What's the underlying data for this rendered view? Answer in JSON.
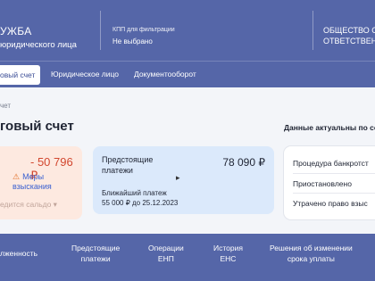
{
  "header": {
    "brand_title": "УЖБА",
    "brand_subtitle": "юридического лица",
    "kpp_label": "КПП для фильтрации",
    "kpp_value": "Не выбрано",
    "org_line1": "ОБЩЕСТВО С",
    "org_line2": "ОТВЕТСТВЕНН"
  },
  "tabs": [
    {
      "label": "овый счет"
    },
    {
      "label": "Юридическое лицо"
    },
    {
      "label": "Документооборот"
    }
  ],
  "main": {
    "breadcrumb": "чет",
    "title": "говый счет",
    "actual_note": "Данные актуальны по со"
  },
  "debt_card": {
    "amount": "- 50 796 ₽",
    "action": "Меры взыскания",
    "note": "едится сальдо ▾"
  },
  "upcoming_card": {
    "title_line1": "Предстоящие",
    "title_line2": "платежи",
    "amount": "78 090 ₽",
    "next_label": "Ближайший платеж",
    "next_value": "55 000 ₽ до 25.12.2023"
  },
  "status_card": {
    "items": [
      "Процедура банкротст",
      "Приостановлено",
      "Утрачено право взыс"
    ]
  },
  "footer": {
    "items": [
      {
        "line1": "лженность",
        "line2": ""
      },
      {
        "line1": "Предстоящие",
        "line2": "платежи"
      },
      {
        "line1": "Операции",
        "line2": "ЕНП"
      },
      {
        "line1": "История",
        "line2": "ЕНС"
      },
      {
        "line1": "Решения об изменении",
        "line2": "срока уплаты"
      }
    ]
  },
  "colors": {
    "header_bg": "#5566a8",
    "debt_red": "#d2472f",
    "upcoming_bg": "#dbe9fb",
    "debt_bg": "#fde9e0"
  }
}
